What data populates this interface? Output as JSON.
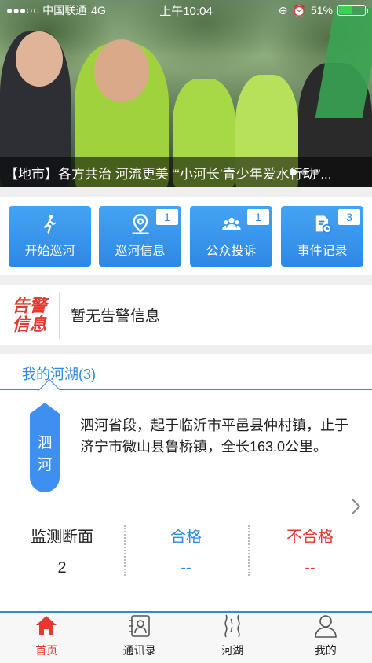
{
  "status_bar": {
    "carrier": "●●●○○ 中国联通",
    "network": "4G",
    "time": "上午10:04",
    "battery": "51%"
  },
  "hero": {
    "caption": "【地市】各方共治 河流更美 “‘小河长’青少年爱水行动”..."
  },
  "actions": [
    {
      "label": "开始巡河",
      "icon": "walk-icon",
      "badge": ""
    },
    {
      "label": "巡河信息",
      "icon": "map-pin-icon",
      "badge": "1"
    },
    {
      "label": "公众投诉",
      "icon": "group-icon",
      "badge": "1"
    },
    {
      "label": "事件记录",
      "icon": "document-clock-icon",
      "badge": "3"
    }
  ],
  "alert": {
    "logo_line1": "告警",
    "logo_line2": "信息",
    "text": "暂无告警信息"
  },
  "river": {
    "tab_label": "我的河湖(3)",
    "tag_line1": "泗",
    "tag_line2": "河",
    "description": "泗河省段，起于临沂市平邑县仲村镇，止于济宁市微山县鲁桥镇，全长163.0公里。",
    "stats": [
      {
        "label": "监测断面",
        "value": "2"
      },
      {
        "label": "合格",
        "value": "--"
      },
      {
        "label": "不合格",
        "value": "--"
      }
    ]
  },
  "tabbar": [
    {
      "label": "首页",
      "icon": "home-icon",
      "active": true
    },
    {
      "label": "通讯录",
      "icon": "contacts-icon",
      "active": false
    },
    {
      "label": "河湖",
      "icon": "river-icon",
      "active": false
    },
    {
      "label": "我的",
      "icon": "user-icon",
      "active": false
    }
  ],
  "colors": {
    "primary": "#2e88e4",
    "alert_red": "#e23a2e"
  }
}
